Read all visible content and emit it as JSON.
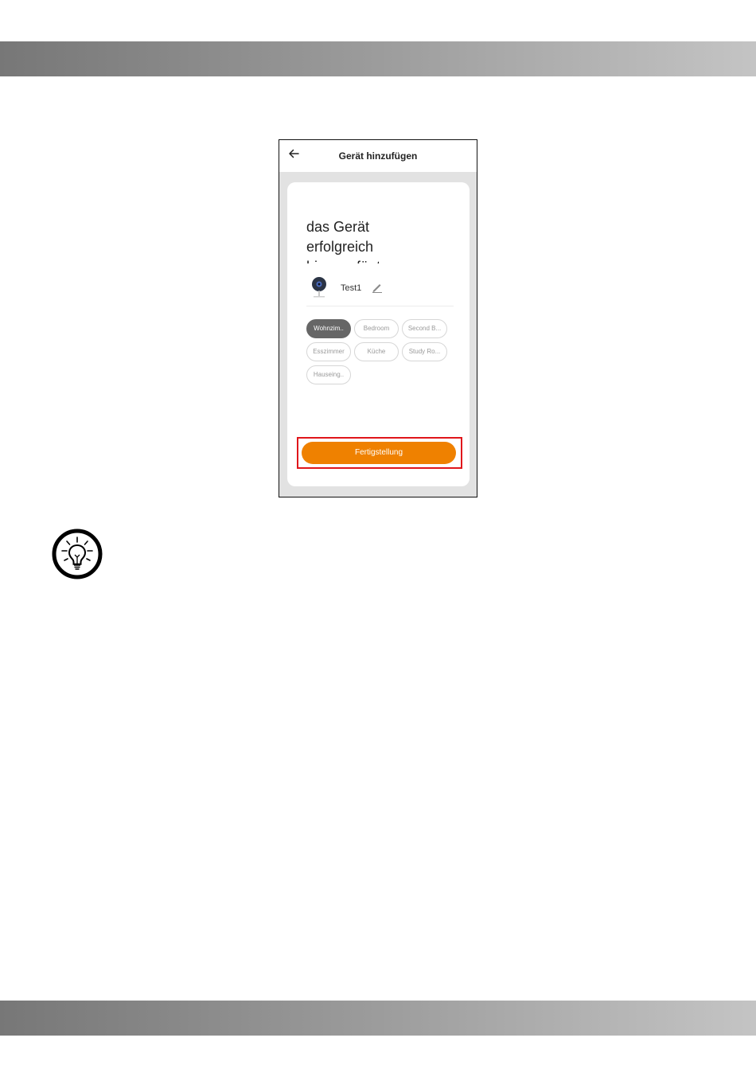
{
  "app": {
    "title": "Gerät hinzufügen",
    "headline_lines": [
      "das Gerät",
      "erfolgreich",
      "hinzugefügt"
    ],
    "device_name": "Test1",
    "rooms": [
      {
        "label": "Wohnzim..",
        "selected": true
      },
      {
        "label": "Bedroom",
        "selected": false
      },
      {
        "label": "Second B...",
        "selected": false
      },
      {
        "label": "Esszimmer",
        "selected": false
      },
      {
        "label": "Küche",
        "selected": false
      },
      {
        "label": "Study Ro...",
        "selected": false
      },
      {
        "label": "Hauseing..",
        "selected": false
      }
    ],
    "finish_button": "Fertigstellung"
  },
  "icons": {
    "back": "arrow-left-icon",
    "device": "camera-icon",
    "edit": "pencil-icon",
    "tip": "lightbulb-icon"
  },
  "colors": {
    "accent": "#ef8100",
    "highlight": "#e0161b",
    "chip_selected": "#666666"
  }
}
